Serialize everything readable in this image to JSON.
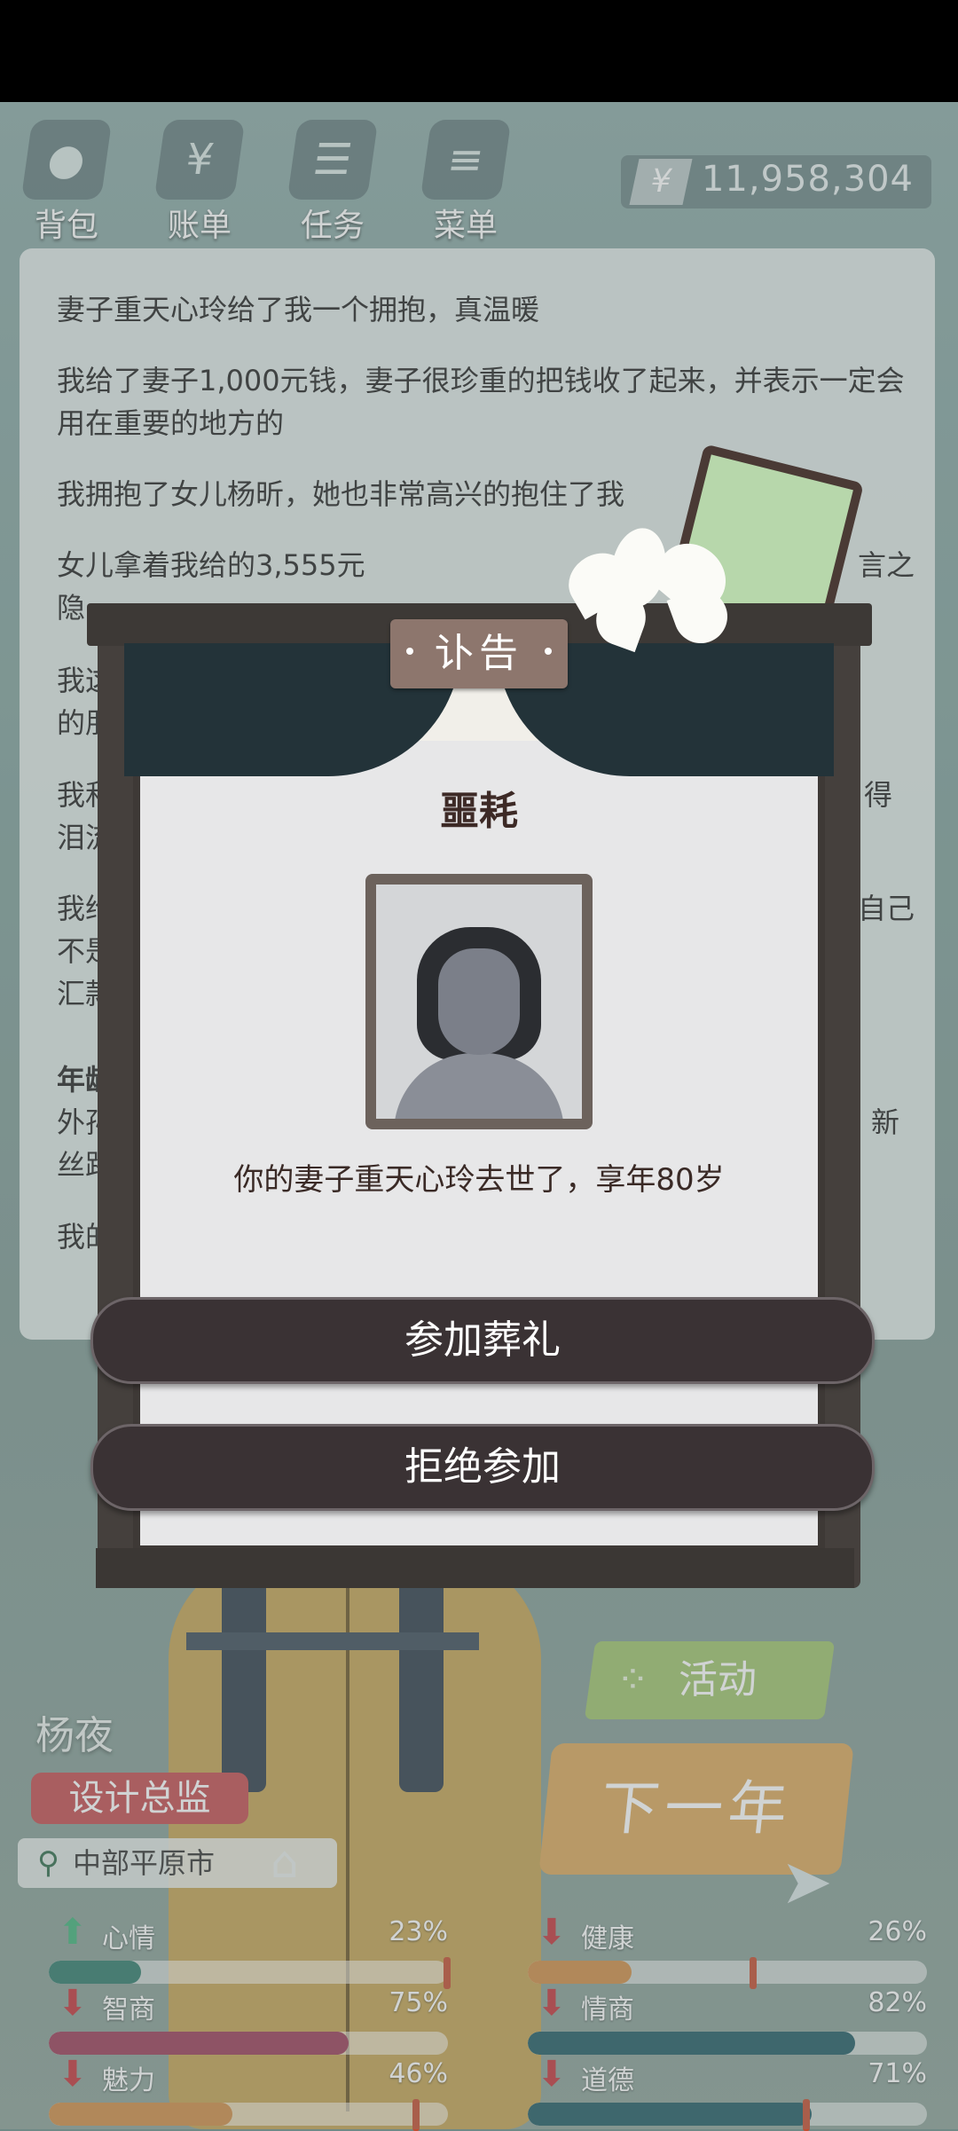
{
  "top_nav": {
    "items": [
      {
        "label": "背包",
        "icon": "bag-icon"
      },
      {
        "label": "账单",
        "icon": "bill-icon"
      },
      {
        "label": "任务",
        "icon": "task-icon"
      },
      {
        "label": "菜单",
        "icon": "menu-icon"
      }
    ],
    "money": {
      "symbol": "¥",
      "amount": "11,958,304"
    }
  },
  "log": {
    "entries": [
      "妻子重天心玲给了我一个拥抱，真温暖",
      "我给了妻子1,000元钱，妻子很珍重的把钱收了起来，并表示一定会用在重要的地方的",
      "我拥抱了女儿杨昕，她也非常高兴的抱住了我",
      "女儿拿着我给的3,555元",
      "隐",
      "言之",
      "我这",
      "的朋",
      "我和",
      "得",
      "泪流",
      "我给",
      "自己",
      "不是",
      "汇款",
      "年龄",
      "外孙",
      "新",
      "丝路",
      "我的"
    ]
  },
  "character": {
    "name": "杨夜",
    "job": "设计总监",
    "city": "中部平原市"
  },
  "actions": {
    "activity_label": "活动",
    "next_year_label": "下一年"
  },
  "stats": [
    {
      "label": "心情",
      "percent": "23%",
      "value": 23,
      "color": "#2f7a6a",
      "trend": "up"
    },
    {
      "label": "健康",
      "percent": "26%",
      "value": 26,
      "color": "#cf8c45",
      "trend": "down"
    },
    {
      "label": "智商",
      "percent": "75%",
      "value": 75,
      "color": "#9a3b57",
      "trend": "down"
    },
    {
      "label": "情商",
      "percent": "82%",
      "value": 82,
      "color": "#1f5963",
      "trend": "down"
    },
    {
      "label": "魅力",
      "percent": "46%",
      "value": 46,
      "color": "#cf8c45",
      "trend": "down"
    },
    {
      "label": "道德",
      "percent": "71%",
      "value": 71,
      "color": "#1f5963",
      "trend": "down"
    }
  ],
  "dialog": {
    "tag": "讣告",
    "title": "噩耗",
    "message": "你的妻子重天心玲去世了，享年80岁",
    "attend_label": "参加葬礼",
    "decline_label": "拒绝参加"
  }
}
